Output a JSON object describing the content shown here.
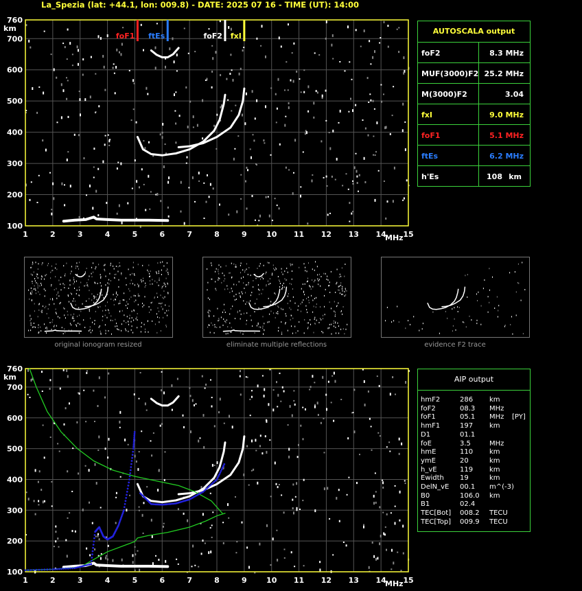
{
  "header": {
    "title": "La_Spezia (lat: +44.1, lon: 009.8) - DATE: 2025 07 16 - TIME (UT): 14:00"
  },
  "colors": {
    "axes": "#ffff3a",
    "grid": "#555555",
    "panel_border": "#3cd43c",
    "trace": "#ffffff",
    "fof1": "#ff2222",
    "ftes": "#2a7dff",
    "fof2": "#ffffff",
    "fxi": "#ffff3a",
    "profile": "#22cc22",
    "model_trace": "#2222dd"
  },
  "autoscala": {
    "title": "AUTOSCALA output",
    "rows": [
      {
        "label": "foF2",
        "value": "8.3 MHz",
        "unit": "",
        "color": "#ffffff"
      },
      {
        "label": "MUF(3000)F2",
        "value": "25.2 MHz",
        "unit": "",
        "color": "#ffffff"
      },
      {
        "label": "M(3000)F2",
        "value": "3.04",
        "unit": "",
        "color": "#ffffff"
      },
      {
        "label": "fxI",
        "value": "9.0 MHz",
        "unit": "",
        "color": "#ffff3a"
      },
      {
        "label": "foF1",
        "value": "5.1 MHz",
        "unit": "",
        "color": "#ff2222"
      },
      {
        "label": "ftEs",
        "value": "6.2 MHz",
        "unit": "",
        "color": "#2a7dff"
      },
      {
        "label": "h'Es",
        "value": "108",
        "unit": "km",
        "color": "#ffffff"
      }
    ]
  },
  "aip": {
    "title": "AIP output",
    "rows": [
      {
        "name": "hmF2",
        "value": "286",
        "unit": "km",
        "flag": ""
      },
      {
        "name": "foF2",
        "value": "08.3",
        "unit": "MHz",
        "flag": ""
      },
      {
        "name": "foF1",
        "value": "05.1",
        "unit": "MHz",
        "flag": "[PY]"
      },
      {
        "name": "hmF1",
        "value": "197",
        "unit": "km",
        "flag": ""
      },
      {
        "name": "D1",
        "value": "01.1",
        "unit": "",
        "flag": ""
      },
      {
        "name": "foE",
        "value": "3.5",
        "unit": "MHz",
        "flag": ""
      },
      {
        "name": "hmE",
        "value": "110",
        "unit": "km",
        "flag": ""
      },
      {
        "name": "ymE",
        "value": "20",
        "unit": "km",
        "flag": ""
      },
      {
        "name": "h_vE",
        "value": "119",
        "unit": "km",
        "flag": ""
      },
      {
        "name": "Ewidth",
        "value": "19",
        "unit": "km",
        "flag": ""
      },
      {
        "name": "DelN_vE",
        "value": "00.1",
        "unit": "m^(-3)",
        "flag": ""
      },
      {
        "name": "B0",
        "value": "106.0",
        "unit": "km",
        "flag": ""
      },
      {
        "name": "B1",
        "value": "02.4",
        "unit": "",
        "flag": ""
      },
      {
        "name": "TEC[Bot]",
        "value": "008.2",
        "unit": "TECU",
        "flag": ""
      },
      {
        "name": "TEC[Top]",
        "value": "009.9",
        "unit": "TECU",
        "flag": ""
      }
    ]
  },
  "thumbnails": [
    {
      "caption": "original ionogram resized"
    },
    {
      "caption": "eliminate multiple reflections"
    },
    {
      "caption": "evidence F2 trace"
    }
  ],
  "chart_data": [
    {
      "type": "scatter",
      "name_shown": "",
      "xlabel": "MHz",
      "ylabel": "km",
      "xlim": [
        1,
        15
      ],
      "ylim": [
        100,
        760
      ],
      "xticks": [
        "1",
        "2",
        "3",
        "4",
        "5",
        "6",
        "7",
        "8",
        "9",
        "10",
        "11",
        "12",
        "13",
        "14",
        "15"
      ],
      "yticks": [
        "100",
        "200",
        "300",
        "400",
        "500",
        "600",
        "700",
        "760"
      ],
      "grid": true,
      "markers": [
        {
          "label": "foF1",
          "x": 5.1,
          "color": "#ff2222"
        },
        {
          "label": "ftEs",
          "x": 6.2,
          "color": "#2a7dff"
        },
        {
          "label": "foF2",
          "x": 8.3,
          "color": "#ffffff"
        },
        {
          "label": "fxI",
          "x": 9.0,
          "color": "#ffff3a"
        }
      ],
      "traces": {
        "es_layer": {
          "x": [
            2.4,
            2.8,
            3.2,
            3.5,
            3.6,
            4.0,
            4.5,
            5.0,
            5.5,
            6.2
          ],
          "y": [
            115,
            118,
            120,
            128,
            122,
            120,
            118,
            118,
            118,
            117
          ]
        },
        "f_ordinary": {
          "x": [
            5.1,
            5.3,
            5.6,
            6.0,
            6.5,
            7.0,
            7.5,
            7.9,
            8.1,
            8.25,
            8.3
          ],
          "y": [
            385,
            345,
            330,
            326,
            332,
            345,
            370,
            405,
            440,
            490,
            520
          ]
        },
        "f_extraordinary": {
          "x": [
            6.6,
            7.0,
            7.5,
            8.0,
            8.5,
            8.8,
            8.95,
            9.0
          ],
          "y": [
            352,
            355,
            365,
            385,
            415,
            455,
            500,
            540
          ]
        },
        "f_multiple": {
          "x": [
            5.6,
            5.8,
            6.0,
            6.2,
            6.4,
            6.6
          ],
          "y": [
            662,
            648,
            640,
            640,
            650,
            670
          ]
        }
      }
    },
    {
      "type": "line",
      "xlabel": "MHz",
      "ylabel": "km",
      "xlim": [
        1,
        15
      ],
      "ylim": [
        100,
        760
      ],
      "xticks": [
        "1",
        "2",
        "3",
        "4",
        "5",
        "6",
        "7",
        "8",
        "9",
        "10",
        "11",
        "12",
        "13",
        "14",
        "15"
      ],
      "yticks": [
        "100",
        "200",
        "300",
        "400",
        "500",
        "600",
        "700",
        "760"
      ],
      "grid": true,
      "series": [
        {
          "name": "",
          "color": "#22cc22",
          "x": [
            1.15,
            1.4,
            1.8,
            2.3,
            2.9,
            3.5,
            4.2,
            5.0,
            5.8,
            6.6,
            7.2,
            7.8,
            8.2
          ],
          "y": [
            760,
            700,
            620,
            555,
            500,
            460,
            430,
            410,
            395,
            380,
            360,
            330,
            290
          ]
        },
        {
          "name": "",
          "color": "#22cc22",
          "x": [
            1.0,
            2.0,
            3.0,
            3.5,
            4.0,
            4.6,
            5.0,
            5.1,
            5.5,
            6.2,
            7.0,
            7.6,
            8.0,
            8.3
          ],
          "y": [
            105,
            108,
            115,
            140,
            165,
            185,
            198,
            210,
            218,
            228,
            245,
            265,
            282,
            290
          ]
        },
        {
          "name": "",
          "color": "#2222dd",
          "x": [
            1.0,
            2.0,
            2.8,
            3.4,
            3.55,
            3.7,
            3.85,
            4.0,
            4.2,
            4.4,
            4.6,
            4.8,
            4.95,
            5.0
          ],
          "y": [
            105,
            108,
            112,
            125,
            230,
            245,
            215,
            205,
            215,
            250,
            300,
            400,
            500,
            560
          ]
        },
        {
          "name": "",
          "color": "#2222dd",
          "x": [
            5.2,
            5.6,
            6.0,
            6.5,
            7.0,
            7.5,
            8.0,
            8.3
          ],
          "y": [
            355,
            320,
            318,
            322,
            335,
            360,
            400,
            455
          ]
        }
      ]
    }
  ]
}
